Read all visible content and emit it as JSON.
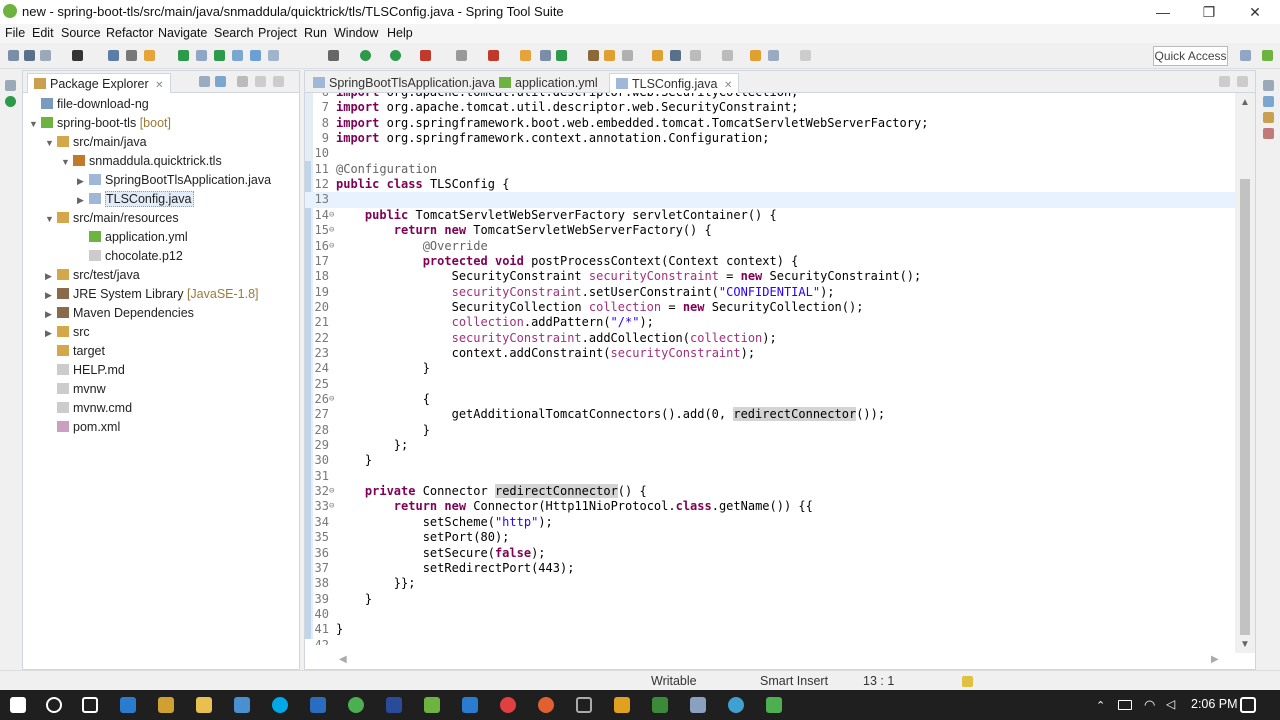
{
  "window": {
    "title": "new - spring-boot-tls/src/main/java/snmaddula/quicktrick/tls/TLSConfig.java - Spring Tool Suite",
    "controls": [
      "—",
      "❐",
      "✕"
    ]
  },
  "menu": [
    "File",
    "Edit",
    "Source",
    "Refactor",
    "Navigate",
    "Search",
    "Project",
    "Run",
    "Window",
    "Help"
  ],
  "toolbar": {
    "quick_access": "Quick Access"
  },
  "package_explorer": {
    "tab_label": "Package Explorer",
    "close_glyph": "✕",
    "items": [
      {
        "label": "file-download-ng",
        "decoration": "",
        "icon": "project-icon"
      },
      {
        "label": "spring-boot-tls",
        "decoration": "[boot]",
        "icon": "spring-project-icon"
      },
      {
        "label": "src/main/java",
        "decoration": "",
        "icon": "source-folder-icon"
      },
      {
        "label": "snmaddula.quicktrick.tls",
        "decoration": "",
        "icon": "package-icon"
      },
      {
        "label": "SpringBootTlsApplication.java",
        "decoration": "",
        "icon": "java-file-icon"
      },
      {
        "label": "TLSConfig.java",
        "decoration": "",
        "icon": "java-file-icon"
      },
      {
        "label": "src/main/resources",
        "decoration": "",
        "icon": "source-folder-icon"
      },
      {
        "label": "application.yml",
        "decoration": "",
        "icon": "yaml-file-icon"
      },
      {
        "label": "chocolate.p12",
        "decoration": "",
        "icon": "file-icon"
      },
      {
        "label": "src/test/java",
        "decoration": "",
        "icon": "source-folder-icon"
      },
      {
        "label": "JRE System Library",
        "decoration": "[JavaSE-1.8]",
        "icon": "library-icon"
      },
      {
        "label": "Maven Dependencies",
        "decoration": "",
        "icon": "library-icon"
      },
      {
        "label": "src",
        "decoration": "",
        "icon": "folder-icon"
      },
      {
        "label": "target",
        "decoration": "",
        "icon": "folder-icon"
      },
      {
        "label": "HELP.md",
        "decoration": "",
        "icon": "file-icon"
      },
      {
        "label": "mvnw",
        "decoration": "",
        "icon": "file-icon"
      },
      {
        "label": "mvnw.cmd",
        "decoration": "",
        "icon": "file-icon"
      },
      {
        "label": "pom.xml",
        "decoration": "",
        "icon": "xml-file-icon"
      }
    ]
  },
  "editor": {
    "tabs": [
      {
        "label": "SpringBootTlsApplication.java",
        "active": false
      },
      {
        "label": "application.yml",
        "active": false
      },
      {
        "label": "TLSConfig.java",
        "active": true
      }
    ],
    "lines": [
      {
        "n": "6",
        "text": "import org.apache.tomcat.util.descriptor.web.SecurityCollection;"
      },
      {
        "n": "7",
        "text": "import org.apache.tomcat.util.descriptor.web.SecurityConstraint;"
      },
      {
        "n": "8",
        "text": "import org.springframework.boot.web.embedded.tomcat.TomcatServletWebServerFactory;"
      },
      {
        "n": "9",
        "text": "import org.springframework.context.annotation.Configuration;"
      },
      {
        "n": "10",
        "text": ""
      },
      {
        "n": "11",
        "text": "@Configuration"
      },
      {
        "n": "12",
        "text": "public class TLSConfig {"
      },
      {
        "n": "13",
        "text": ""
      },
      {
        "n": "14",
        "text": "    public TomcatServletWebServerFactory servletContainer() {"
      },
      {
        "n": "15",
        "text": "        return new TomcatServletWebServerFactory() {"
      },
      {
        "n": "16",
        "text": "            @Override"
      },
      {
        "n": "17",
        "text": "            protected void postProcessContext(Context context) {"
      },
      {
        "n": "18",
        "text": "                SecurityConstraint securityConstraint = new SecurityConstraint();"
      },
      {
        "n": "19",
        "text": "                securityConstraint.setUserConstraint(\"CONFIDENTIAL\");"
      },
      {
        "n": "20",
        "text": "                SecurityCollection collection = new SecurityCollection();"
      },
      {
        "n": "21",
        "text": "                collection.addPattern(\"/*\");"
      },
      {
        "n": "22",
        "text": "                securityConstraint.addCollection(collection);"
      },
      {
        "n": "23",
        "text": "                context.addConstraint(securityConstraint);"
      },
      {
        "n": "24",
        "text": "            }"
      },
      {
        "n": "25",
        "text": ""
      },
      {
        "n": "26",
        "text": "            {"
      },
      {
        "n": "27",
        "text": "                getAdditionalTomcatConnectors().add(0, redirectConnector());"
      },
      {
        "n": "28",
        "text": "            }"
      },
      {
        "n": "29",
        "text": "        };"
      },
      {
        "n": "30",
        "text": "    }"
      },
      {
        "n": "31",
        "text": ""
      },
      {
        "n": "32",
        "text": "    private Connector redirectConnector() {"
      },
      {
        "n": "33",
        "text": "        return new Connector(Http11NioProtocol.class.getName()) {{"
      },
      {
        "n": "34",
        "text": "            setScheme(\"http\");"
      },
      {
        "n": "35",
        "text": "            setPort(80);"
      },
      {
        "n": "36",
        "text": "            setSecure(false);"
      },
      {
        "n": "37",
        "text": "            setRedirectPort(443);"
      },
      {
        "n": "38",
        "text": "        }};"
      },
      {
        "n": "39",
        "text": "    }"
      },
      {
        "n": "40",
        "text": ""
      },
      {
        "n": "41",
        "text": "}"
      },
      {
        "n": "42",
        "text": ""
      }
    ]
  },
  "status": {
    "mode": "Writable",
    "insert": "Smart Insert",
    "position": "13 : 1"
  },
  "taskbar": {
    "time": "2:06 PM"
  },
  "colors": {
    "keyword": "#7f0055",
    "string": "#2a00ff",
    "annotation": "#646464",
    "field": "#a0307d",
    "spring_green": "#6db33f",
    "taskbar": "#1f1f1f"
  }
}
